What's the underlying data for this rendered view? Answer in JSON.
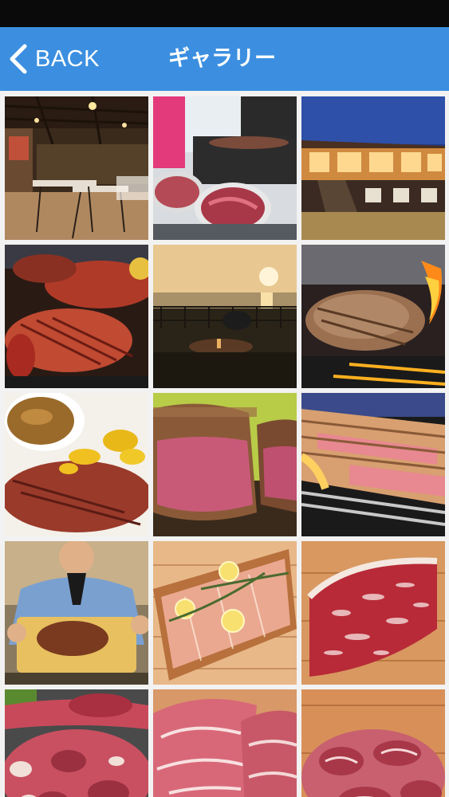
{
  "nav": {
    "back_label": "BACK",
    "title": "ギャラリー",
    "bar_color": "#3c8fe0"
  },
  "gallery": {
    "photos": [
      {
        "subject": "restaurant-interior"
      },
      {
        "subject": "grilling-meat-on-tray"
      },
      {
        "subject": "restaurant-exterior-night"
      },
      {
        "subject": "grilled-meat-platter"
      },
      {
        "subject": "sunset-ocean-view-terrace"
      },
      {
        "subject": "steak-on-flaming-grill"
      },
      {
        "subject": "steak-with-sauce-and-potatoes"
      },
      {
        "subject": "rare-steak-cut"
      },
      {
        "subject": "sliced-steak-on-grill"
      },
      {
        "subject": "chef-holding-steak-board"
      },
      {
        "subject": "salmon-with-lemon-on-plank"
      },
      {
        "subject": "marbled-wagyu-beef"
      },
      {
        "subject": "mixed-meat-platter"
      },
      {
        "subject": "raw-pork-slices"
      },
      {
        "subject": "raw-meat-chunks"
      }
    ]
  }
}
